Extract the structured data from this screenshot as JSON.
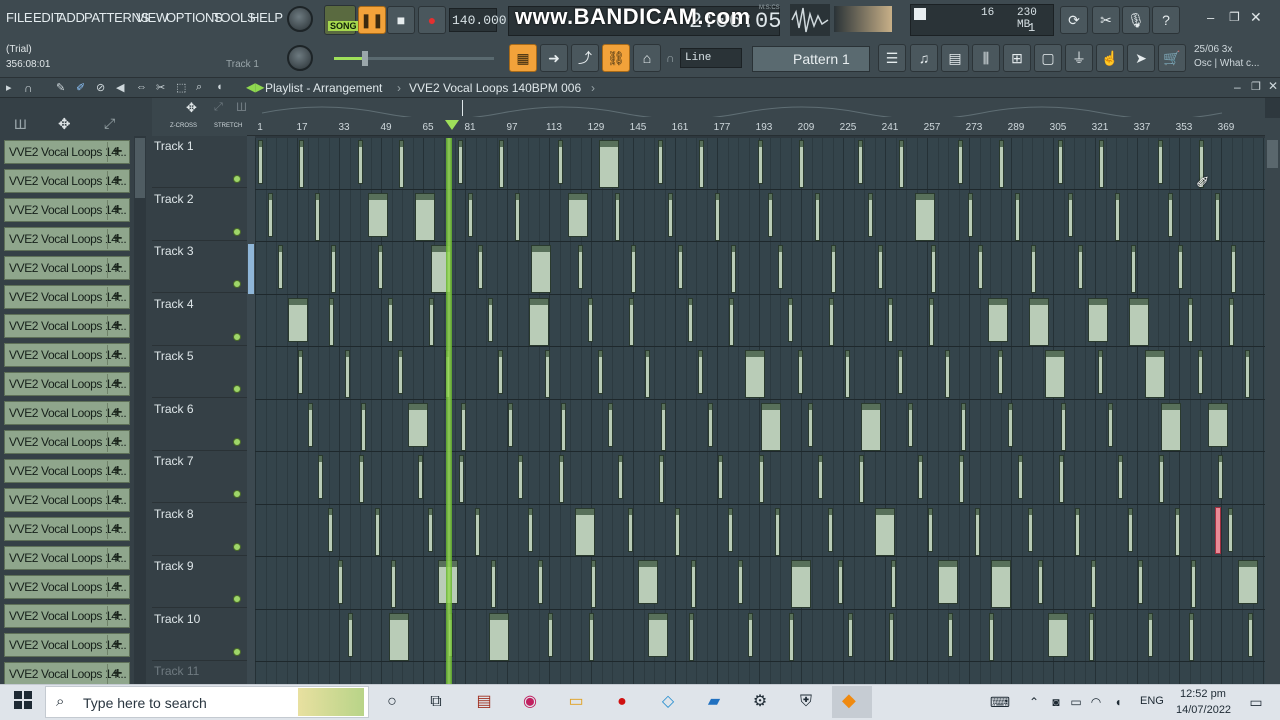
{
  "menu": {
    "items": [
      "FILE",
      "EDIT",
      "ADD",
      "PATTERNS",
      "VIEW",
      "OPTIONS",
      "TOOLS",
      "HELP"
    ]
  },
  "transport": {
    "mode_label": "SONG",
    "tempo": "140.000",
    "time_display": "2:06:05",
    "time_unit": "M:S:CS"
  },
  "monitor": {
    "cpu_value": "16",
    "memory": "230 MB",
    "voices": "1"
  },
  "watermark": "www.BANDICAM.com",
  "hint_bar": {
    "line1": "(Trial)",
    "line2": "356:08:01",
    "track_label": "Track 1"
  },
  "toolbar": {
    "snap_mode": "Line",
    "pattern_name": "Pattern 1",
    "news_line1": "25/06  3x",
    "news_line2": "Osc | What c..."
  },
  "playlist": {
    "title": "Playlist - Arrangement",
    "breadcrumb_sep": "›",
    "project": "VVE2 Vocal Loops 140BPM 006",
    "zcross": "Z-CROSS",
    "stretch": "STRETCH"
  },
  "ruler_ticks": [
    "1",
    "17",
    "33",
    "49",
    "65",
    "81",
    "97",
    "113",
    "129",
    "145",
    "161",
    "177",
    "193",
    "209",
    "225",
    "241",
    "257",
    "273",
    "289",
    "305",
    "321",
    "337",
    "353",
    "369"
  ],
  "channels": [
    "VVE2 Vocal Loops 14...",
    "VVE2 Vocal Loops 14...",
    "VVE2 Vocal Loops 14...",
    "VVE2 Vocal Loops 14...",
    "VVE2 Vocal Loops 14...",
    "VVE2 Vocal Loops 14...",
    "VVE2 Vocal Loops 14...",
    "VVE2 Vocal Loops 14...",
    "VVE2 Vocal Loops 14...",
    "VVE2 Vocal Loops 14...",
    "VVE2 Vocal Loops 14...",
    "VVE2 Vocal Loops 14...",
    "VVE2 Vocal Loops 14...",
    "VVE2 Vocal Loops 14...",
    "VVE2 Vocal Loops 14...",
    "VVE2 Vocal Loops 14...",
    "VVE2 Vocal Loops 14...",
    "VVE2 Vocal Loops 14...",
    "VVE2 Vocal Loops 14..."
  ],
  "tracks": [
    "Track 1",
    "Track 2",
    "Track 3",
    "Track 4",
    "Track 5",
    "Track 6",
    "Track 7",
    "Track 8",
    "Track 9",
    "Track 10",
    "Track 11"
  ],
  "taskbar": {
    "search_placeholder": "Type here to search",
    "language": "ENG",
    "time": "12:52 pm",
    "date": "14/07/2022"
  },
  "colors": {
    "clip": "#b9ccb7",
    "clip_header": "#58705a",
    "playhead": "#8fd94f",
    "toolbar_active": "#f2a23a",
    "grid": "#34444b"
  }
}
